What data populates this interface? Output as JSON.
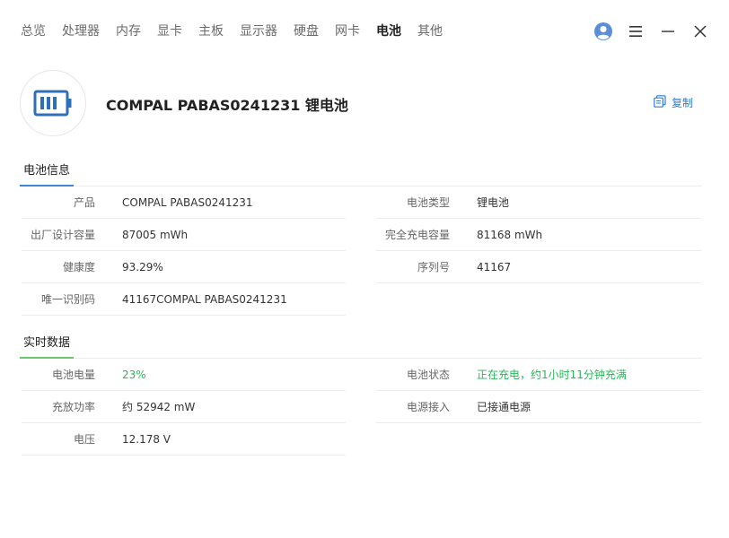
{
  "nav": {
    "tabs": [
      "总览",
      "处理器",
      "内存",
      "显卡",
      "主板",
      "显示器",
      "硬盘",
      "网卡",
      "电池",
      "其他"
    ],
    "active_index": 8
  },
  "window": {
    "icons": [
      "avatar-icon",
      "menu-icon",
      "minimize-icon",
      "close-icon"
    ]
  },
  "header": {
    "title": "COMPAL PABAS0241231 锂电池",
    "icon": "battery-icon",
    "copy_label": "复制",
    "copy_icon": "copy-icon"
  },
  "battery_info": {
    "section_title": "电池信息",
    "rows_left": [
      {
        "label": "产品",
        "value": "COMPAL PABAS0241231"
      },
      {
        "label": "出厂设计容量",
        "value": "87005 mWh"
      },
      {
        "label": "健康度",
        "value": "93.29%"
      },
      {
        "label": "唯一识别码",
        "value": "41167COMPAL PABAS0241231"
      }
    ],
    "rows_right": [
      {
        "label": "电池类型",
        "value": "锂电池"
      },
      {
        "label": "完全充电容量",
        "value": "81168 mWh"
      },
      {
        "label": "序列号",
        "value": "41167"
      }
    ]
  },
  "realtime": {
    "section_title": "实时数据",
    "rows_left": [
      {
        "label": "电池电量",
        "value": "23%"
      },
      {
        "label": "充放功率",
        "value": "约 52942 mW"
      },
      {
        "label": "电压",
        "value": "12.178 V"
      }
    ],
    "rows_right": [
      {
        "label": "电池状态",
        "value": "正在充电，约1小时11分钟充满"
      },
      {
        "label": "电源接入",
        "value": "已接通电源"
      }
    ]
  },
  "colors": {
    "accent_blue": "#3b86d6",
    "accent_green": "#6cc56f",
    "status_green": "#2ab55a",
    "battery_icon": "#2f6fb8"
  }
}
